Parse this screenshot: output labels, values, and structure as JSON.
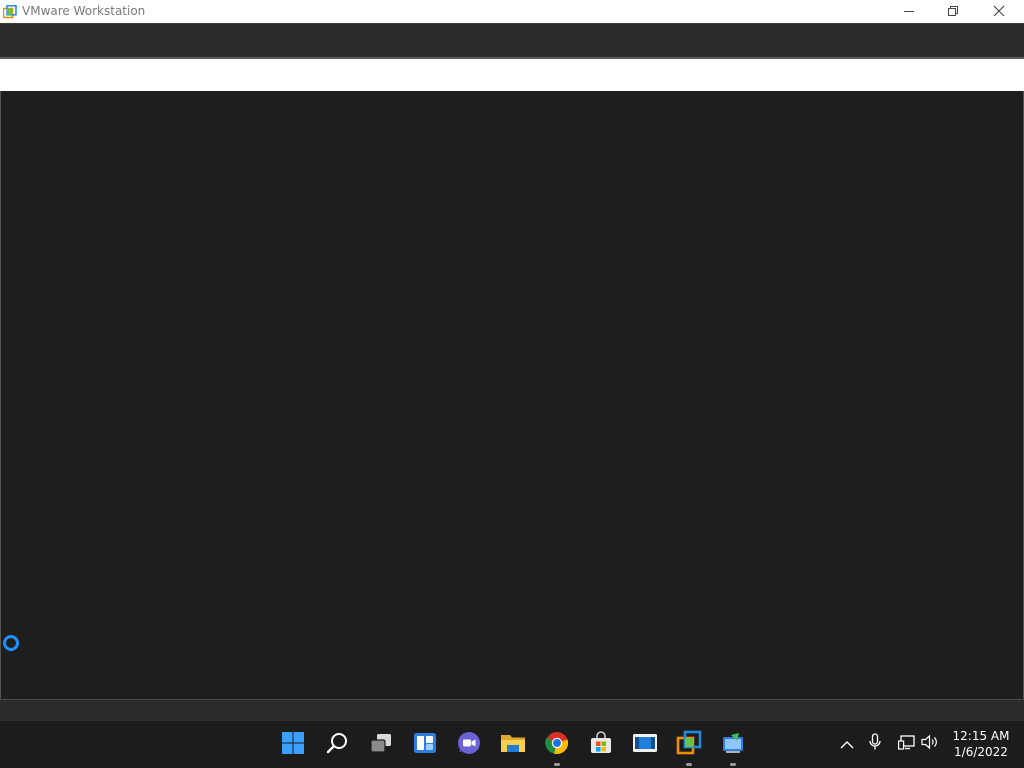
{
  "window": {
    "title": "VMware Workstation",
    "icon": "vmware-icon",
    "controls": {
      "minimize": "minimize-icon",
      "restore": "restore-icon",
      "close": "close-icon"
    }
  },
  "guest": {
    "state": "loading",
    "spinner_color": "#1e90ff",
    "background_color": "#1e1e1e"
  },
  "taskbar": {
    "pinned": [
      {
        "name": "start",
        "icon": "windows-start-icon"
      },
      {
        "name": "search",
        "icon": "search-icon"
      },
      {
        "name": "task-view",
        "icon": "task-view-icon"
      },
      {
        "name": "widgets",
        "icon": "widgets-icon"
      },
      {
        "name": "chat",
        "icon": "teams-chat-icon"
      },
      {
        "name": "file-explorer",
        "icon": "folder-icon"
      },
      {
        "name": "chrome",
        "icon": "chrome-icon",
        "running": true
      },
      {
        "name": "store",
        "icon": "store-icon"
      },
      {
        "name": "media",
        "icon": "media-player-icon"
      },
      {
        "name": "vmware",
        "icon": "vmware-icon",
        "running": true
      },
      {
        "name": "installer",
        "icon": "installer-icon",
        "running": true
      }
    ],
    "tray": {
      "chevron": "chevron-up-icon",
      "mic": "microphone-icon",
      "network": "network-icon",
      "volume": "volume-icon"
    },
    "clock": {
      "time": "12:15 AM",
      "date": "1/6/2022"
    }
  }
}
